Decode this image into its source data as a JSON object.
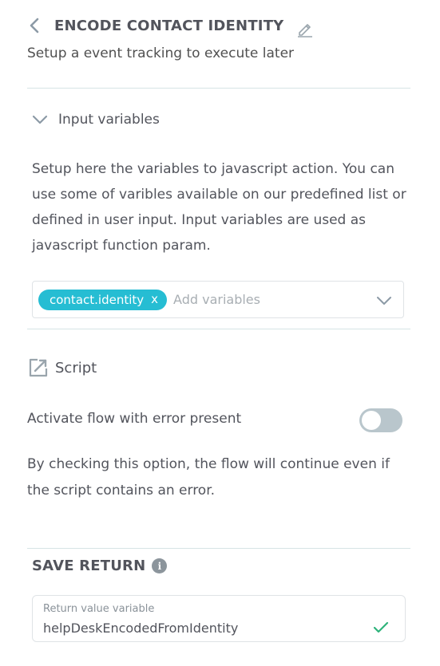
{
  "header": {
    "title": "ENCODE CONTACT IDENTITY",
    "subtitle": "Setup a event tracking to execute later"
  },
  "input_variables": {
    "label": "Input variables",
    "description": "Setup here the variables to javascript action. You can use some of varibles available on our predefined list or defined in user input. Input variables are used as javascript function param.",
    "selected": [
      "contact.identity"
    ],
    "chip_remove": "x",
    "placeholder": "Add variables",
    "expanded": true
  },
  "script": {
    "label": "Script"
  },
  "error_flow": {
    "label": "Activate flow with error present",
    "enabled": false,
    "help": "By checking this option, the flow will continue even if the script contains an error."
  },
  "save_return": {
    "title": "SAVE RETURN",
    "info": "i",
    "field_label": "Return value variable",
    "field_value": "helpDeskEncodedFromIdentity",
    "valid": true
  },
  "colors": {
    "accent": "#26bdd3",
    "text": "#52545c",
    "toggle_off": "#b9c6cc",
    "valid_check": "#2eb37b",
    "divider": "#d6e4e5"
  },
  "icons": {
    "back": "chevron-left-icon",
    "edit": "pencil-icon",
    "collapse": "chevron-down-icon",
    "dropdown": "chevron-down-icon",
    "script": "external-link-icon",
    "info": "info-icon",
    "valid": "check-icon"
  }
}
